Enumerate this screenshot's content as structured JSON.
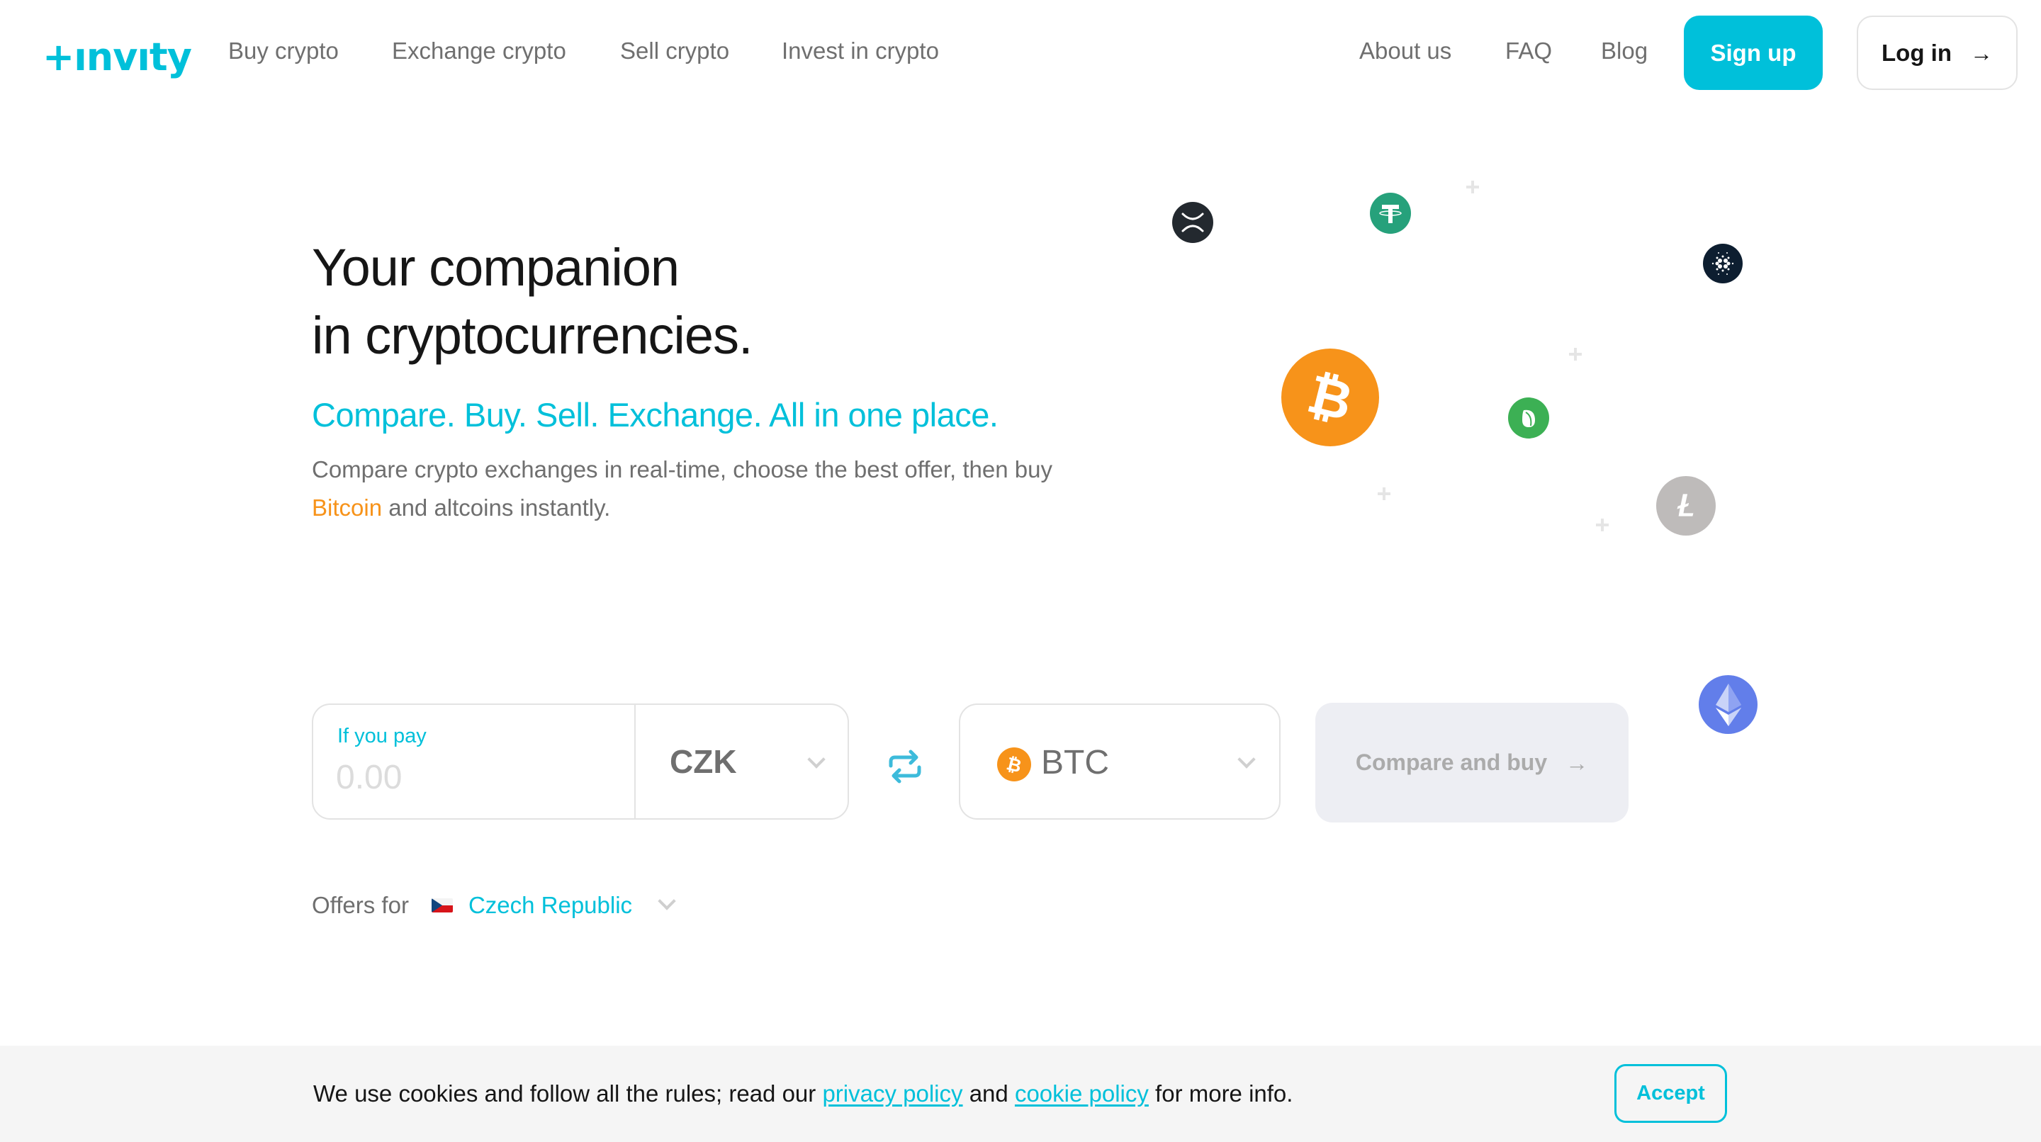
{
  "header": {
    "logo_text": "+ınvıty",
    "nav_left": [
      {
        "label": "Buy crypto"
      },
      {
        "label": "Exchange crypto"
      },
      {
        "label": "Sell crypto"
      },
      {
        "label": "Invest in crypto"
      }
    ],
    "nav_right": [
      {
        "label": "About us"
      },
      {
        "label": "FAQ"
      },
      {
        "label": "Blog"
      }
    ],
    "signup_label": "Sign up",
    "login_label": "Log in",
    "login_icon": "arrow-right-icon"
  },
  "hero": {
    "title_line1": "Your companion",
    "title_line2": "in cryptocurrencies.",
    "tagline": "Compare. Buy. Sell. Exchange. All in one place.",
    "description_part1": "Compare crypto exchanges in real-time, choose the best offer, then buy",
    "description_link": "Bitcoin",
    "description_part2": " and altcoins instantly."
  },
  "decorative_coins": [
    "ripple-icon",
    "tether-icon",
    "cardano-icon",
    "bitcoin-icon",
    "peercoin-icon",
    "litecoin-icon",
    "ethereum-icon"
  ],
  "form": {
    "pay_label": "If you pay",
    "pay_placeholder": "0.00",
    "pay_value": "",
    "fiat_currency": "CZK",
    "swap_icon": "swap-arrows-icon",
    "crypto_currency": "BTC",
    "crypto_icon": "bitcoin-icon",
    "compare_label": "Compare and buy",
    "compare_icon": "arrow-right-icon"
  },
  "offers": {
    "label": "Offers for",
    "country": "Czech Republic",
    "flag_icon": "czech-flag-icon"
  },
  "cookie_bar": {
    "text_part1": "We use cookies and follow all the rules; read our ",
    "privacy_link": "privacy policy",
    "text_part2": " and ",
    "cookie_link": "cookie policy",
    "text_part3": " for more info.",
    "accept_label": "Accept"
  },
  "colors": {
    "brand": "#00c0da",
    "bitcoin": "#f7931a",
    "text_dark": "#161616",
    "text_muted": "#6f6f6f",
    "button_disabled_bg": "#edeef3"
  }
}
